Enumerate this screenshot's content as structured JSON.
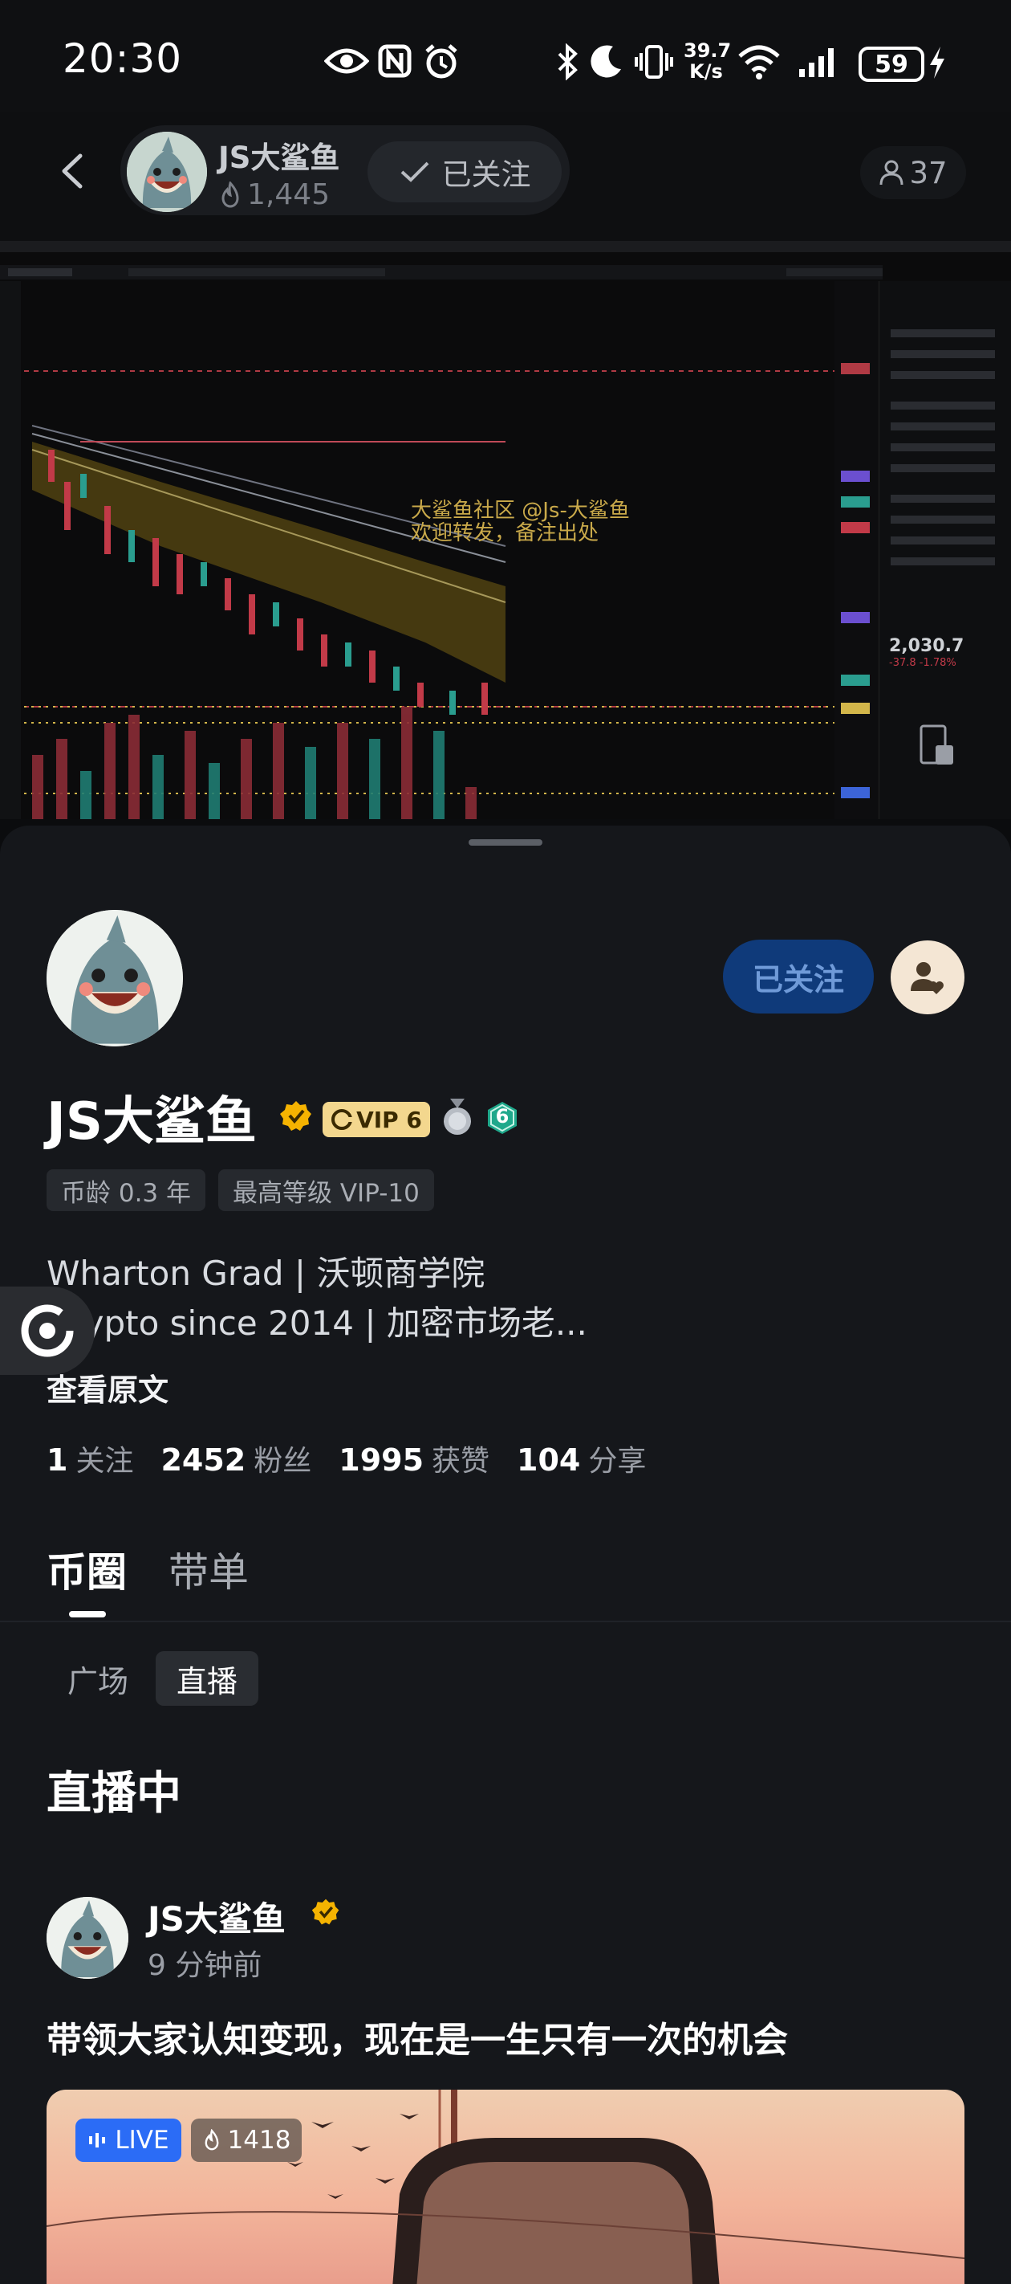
{
  "status_bar": {
    "time": "20:30",
    "net_speed_value": "39.7",
    "net_speed_unit": "K/s",
    "battery": "59"
  },
  "live_header": {
    "host_name": "JS大鲨鱼",
    "host_heat": "1,445",
    "follow_label": "已关注",
    "viewer_count": "37"
  },
  "stream": {
    "watermark_line1": "大鲨鱼社区 @Js-大鲨鱼",
    "watermark_line2": "欢迎转发，备注出处",
    "chart_price": "2,030.7",
    "chart_change": "-37.8 -1.78%"
  },
  "profile": {
    "name": "JS大鲨鱼",
    "vip_label": "VIP 6",
    "level": "6",
    "follow_button": "已关注",
    "chips": [
      "币龄 0.3 年",
      "最高等级 VIP-10"
    ],
    "bio_line1": "Wharton Grad | 沃顿商学院",
    "bio_line2": "Crypto since 2014 | 加密市场老...",
    "view_original": "查看原文",
    "stats": [
      {
        "value": "1",
        "label": "关注"
      },
      {
        "value": "2452",
        "label": "粉丝"
      },
      {
        "value": "1995",
        "label": "获赞"
      },
      {
        "value": "104",
        "label": "分享"
      }
    ]
  },
  "tabs": [
    "币圈",
    "带单"
  ],
  "subtabs": [
    "广场",
    "直播"
  ],
  "live_section": {
    "title": "直播中",
    "post": {
      "author": "JS大鲨鱼",
      "time": "9 分钟前",
      "title": "带领大家认知变现，现在是一生只有一次的机会",
      "live_label": "LIVE",
      "heat": "1418"
    }
  },
  "colors": {
    "accent_blue": "#2b6cf6",
    "followed_bg": "#0f3a7a",
    "vip_gold": "#f3d78e",
    "verified": "#f5b301"
  }
}
